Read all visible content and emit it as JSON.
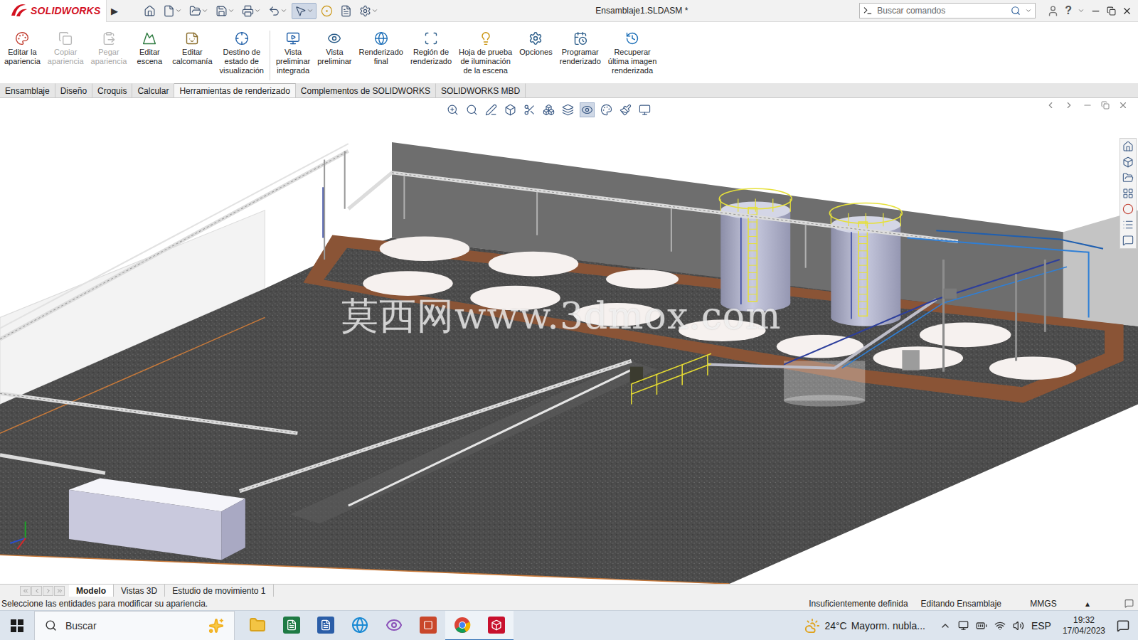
{
  "window": {
    "logo": "SOLIDWORKS",
    "logo_arrow": "▶",
    "title": "Ensamblaje1.SLDASM *",
    "search": {
      "placeholder": "Buscar comandos"
    },
    "help": "?"
  },
  "ribbon": {
    "groups": [
      [
        {
          "lines": [
            "Editar la",
            "apariencia"
          ],
          "disabled": false
        },
        {
          "lines": [
            "Copiar",
            "apariencia"
          ],
          "disabled": true
        },
        {
          "lines": [
            "Pegar",
            "apariencia"
          ],
          "disabled": true
        },
        {
          "lines": [
            "Editar",
            "escena"
          ],
          "disabled": false
        },
        {
          "lines": [
            "Editar",
            "calcomanía"
          ],
          "disabled": false
        },
        {
          "lines": [
            "Destino de",
            "estado de",
            "visualización"
          ],
          "disabled": false
        }
      ],
      [
        {
          "lines": [
            "Vista",
            "preliminar",
            "integrada"
          ],
          "disabled": false
        },
        {
          "lines": [
            "Vista",
            "preliminar"
          ],
          "disabled": false
        },
        {
          "lines": [
            "Renderizado",
            "final"
          ],
          "disabled": false
        },
        {
          "lines": [
            "Región de",
            "renderizado"
          ],
          "disabled": false
        },
        {
          "lines": [
            "Hoja de prueba",
            "de iluminación",
            "de la escena"
          ],
          "disabled": false
        },
        {
          "lines": [
            "Opciones"
          ],
          "disabled": false
        },
        {
          "lines": [
            "Programar",
            "renderizado"
          ],
          "disabled": false
        },
        {
          "lines": [
            "Recuperar",
            "última imagen",
            "renderizada"
          ],
          "disabled": false
        }
      ]
    ]
  },
  "tabs": [
    {
      "label": "Ensamblaje",
      "selected": false
    },
    {
      "label": "Diseño",
      "selected": false
    },
    {
      "label": "Croquis",
      "selected": false
    },
    {
      "label": "Calcular",
      "selected": false
    },
    {
      "label": "Herramientas de renderizado",
      "selected": true
    },
    {
      "label": "Complementos de SOLIDWORKS",
      "selected": false
    },
    {
      "label": "SOLIDWORKS MBD",
      "selected": false
    }
  ],
  "viewport": {
    "watermark": "莫西网www.3dmox.com"
  },
  "model_tabs": [
    {
      "label": "Modelo",
      "selected": true
    },
    {
      "label": "Vistas 3D",
      "selected": false
    },
    {
      "label": "Estudio de movimiento 1",
      "selected": false
    }
  ],
  "status_bar": {
    "message": "Seleccione las entidades para modificar su apariencia.",
    "fields": [
      "Insuficientemente definida",
      "Editando Ensamblaje",
      "MMGS",
      "▴"
    ]
  },
  "taskbar": {
    "search_placeholder": "Buscar",
    "weather": {
      "temperature": "24°C",
      "condition": "Mayorm. nubla..."
    },
    "language": "ESP",
    "time": "19:32",
    "date": "17/04/2023"
  }
}
